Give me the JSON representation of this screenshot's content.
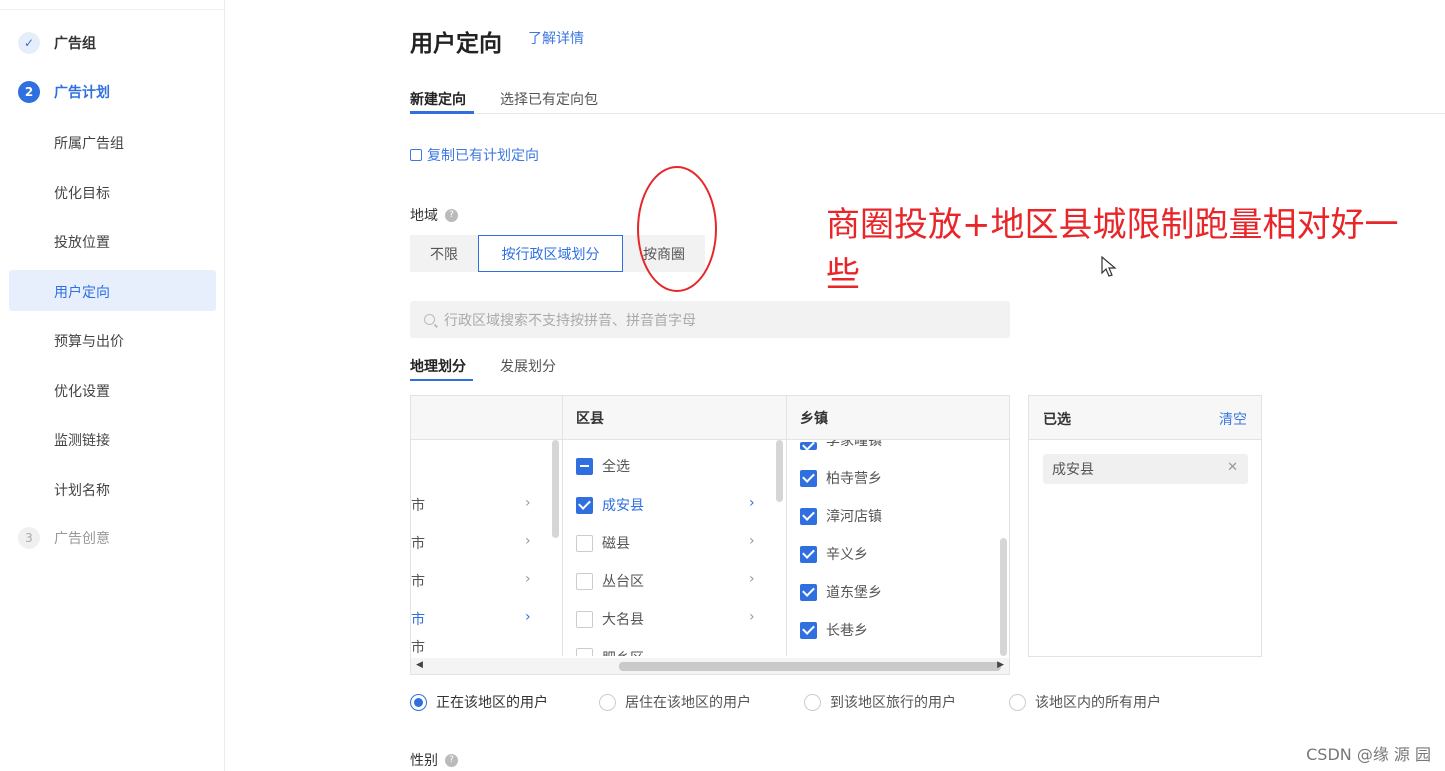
{
  "sidebar": {
    "steps": [
      {
        "number": "✓",
        "label": "广告组",
        "state": "done"
      },
      {
        "number": "2",
        "label": "广告计划",
        "state": "active"
      },
      {
        "number": "3",
        "label": "广告创意",
        "state": "todo"
      }
    ],
    "sub_items": [
      "所属广告组",
      "优化目标",
      "投放位置",
      "用户定向",
      "预算与出价",
      "优化设置",
      "监测链接",
      "计划名称"
    ],
    "selected_sub_item": "用户定向"
  },
  "header": {
    "title": "用户定向",
    "detail_link": "了解详情"
  },
  "tabs": [
    "新建定向",
    "选择已有定向包"
  ],
  "copy_link": "复制已有计划定向",
  "region": {
    "label": "地域",
    "options": [
      "不限",
      "按行政区域划分",
      "按商圈"
    ],
    "selected_option": "按行政区域划分",
    "search_placeholder": "行政区域搜索不支持按拼音、拼音首字母",
    "subtabs": [
      "地理划分",
      "发展划分"
    ],
    "columns": {
      "county_header": "区县",
      "town_header": "乡镇"
    },
    "cities": [
      "市",
      "市",
      "市",
      "市",
      "市"
    ],
    "counties": [
      {
        "label": "全选",
        "state": "partial"
      },
      {
        "label": "成安县",
        "state": "checked"
      },
      {
        "label": "磁县",
        "state": "unchecked"
      },
      {
        "label": "丛台区",
        "state": "unchecked"
      },
      {
        "label": "大名县",
        "state": "unchecked"
      },
      {
        "label": "肥乡区",
        "state": "unchecked"
      }
    ],
    "towns": [
      "李家疃镇",
      "柏寺营乡",
      "漳河店镇",
      "辛义乡",
      "道东堡乡",
      "长巷乡"
    ],
    "selected": {
      "title": "已选",
      "clear": "清空",
      "tags": [
        "成安县"
      ]
    },
    "audience": [
      {
        "label": "正在该地区的用户",
        "on": true
      },
      {
        "label": "居住在该地区的用户",
        "on": false
      },
      {
        "label": "到该地区旅行的用户",
        "on": false
      },
      {
        "label": "该地区内的所有用户",
        "on": false
      }
    ]
  },
  "gender_label": "性别",
  "annotation": "商圈投放+地区县城限制跑量相对好一些",
  "watermark": "CSDN @缘 源 园",
  "colors": {
    "accent": "#2f6fe0",
    "annotation_red": "#e8262a"
  }
}
